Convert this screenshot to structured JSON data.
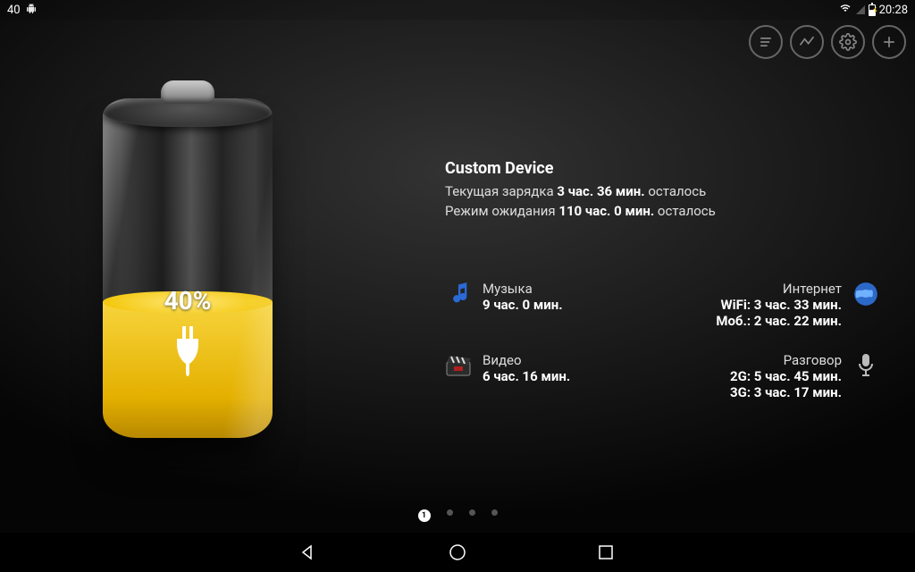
{
  "status_bar": {
    "left_number": "40",
    "time": "20:28"
  },
  "battery": {
    "percent_label": "40%",
    "fill_percent": 40
  },
  "device": {
    "name": "Custom Device",
    "charge_prefix": "Текущая зарядка ",
    "charge_time": "3 час. 36 мин.",
    "charge_suffix": " осталось",
    "standby_prefix": "Режим ожидания ",
    "standby_time": "110 час. 0 мин.",
    "standby_suffix": " осталось"
  },
  "usage": {
    "music": {
      "title": "Музыка",
      "value": "9 час. 0 мин."
    },
    "video": {
      "title": "Видео",
      "value": "6 час. 16 мин."
    },
    "internet": {
      "title": "Интернет",
      "wifi": "WiFi: 3 час. 33 мин.",
      "mobile": "Моб.: 2 час. 22 мин."
    },
    "talk": {
      "title": "Разговор",
      "g2": "2G: 5 час. 45 мин.",
      "g3": "3G: 3 час. 17 мин."
    }
  },
  "pager": {
    "active_index": 0,
    "active_label": "1",
    "count": 4
  },
  "colors": {
    "accent": "#f2c400"
  }
}
